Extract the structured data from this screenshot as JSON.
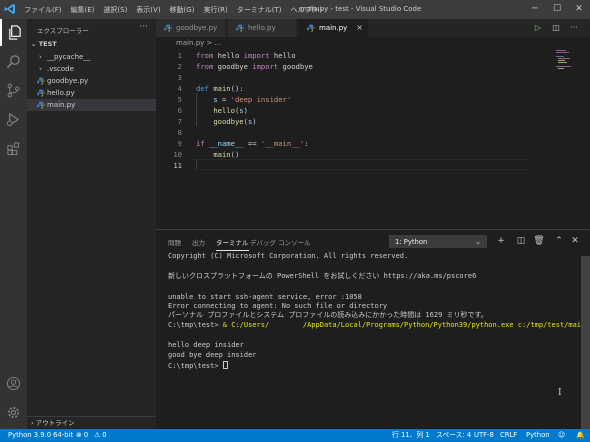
{
  "titlebar": {
    "menu": [
      "ファイル(F)",
      "編集(E)",
      "選択(S)",
      "表示(V)",
      "移動(G)",
      "実行(R)",
      "ターミナル(T)",
      "ヘルプ(H)"
    ],
    "title": "main.py - test - Visual Studio Code",
    "controls": {
      "minimize": "─",
      "maximize": "☐",
      "close": "✕"
    }
  },
  "activity_bar": {
    "items": [
      "explorer-icon",
      "search-icon",
      "source-control-icon",
      "run-debug-icon",
      "extensions-icon"
    ],
    "bottom": [
      "account-icon",
      "settings-gear-icon"
    ]
  },
  "sidebar": {
    "header": "エクスプローラー",
    "more": "···",
    "folder": "TEST",
    "items": [
      {
        "label": "__pycache__",
        "type": "folder"
      },
      {
        "label": ".vscode",
        "type": "folder"
      },
      {
        "label": "goodbye.py",
        "type": "python"
      },
      {
        "label": "hello.py",
        "type": "python"
      },
      {
        "label": "main.py",
        "type": "python",
        "selected": true
      }
    ],
    "outline": "アウトライン"
  },
  "tabs": [
    {
      "label": "goodbye.py",
      "active": false
    },
    {
      "label": "hello.py",
      "active": false
    },
    {
      "label": "main.py",
      "active": true,
      "close": "×"
    }
  ],
  "breadcrumb": "main.py > ...",
  "editor": {
    "lines": [
      {
        "n": "1",
        "tokens": [
          [
            "kw",
            "from"
          ],
          [
            "plain",
            " hello "
          ],
          [
            "kw",
            "import"
          ],
          [
            "plain",
            " hello"
          ]
        ]
      },
      {
        "n": "2",
        "tokens": [
          [
            "kw",
            "from"
          ],
          [
            "plain",
            " goodbye "
          ],
          [
            "kw",
            "import"
          ],
          [
            "plain",
            " goodbye"
          ]
        ]
      },
      {
        "n": "3",
        "tokens": []
      },
      {
        "n": "4",
        "tokens": [
          [
            "kw2",
            "def"
          ],
          [
            "plain",
            " "
          ],
          [
            "fn",
            "main"
          ],
          [
            "plain",
            "():"
          ]
        ]
      },
      {
        "n": "5",
        "tokens": [
          [
            "plain",
            "    "
          ],
          [
            "var",
            "s"
          ],
          [
            "plain",
            " = "
          ],
          [
            "str",
            "'deep insider'"
          ]
        ]
      },
      {
        "n": "6",
        "tokens": [
          [
            "plain",
            "    "
          ],
          [
            "fn",
            "hello"
          ],
          [
            "plain",
            "("
          ],
          [
            "var",
            "s"
          ],
          [
            "plain",
            ")"
          ]
        ]
      },
      {
        "n": "7",
        "tokens": [
          [
            "plain",
            "    "
          ],
          [
            "fn",
            "goodbye"
          ],
          [
            "plain",
            "("
          ],
          [
            "var",
            "s"
          ],
          [
            "plain",
            ")"
          ]
        ]
      },
      {
        "n": "8",
        "tokens": []
      },
      {
        "n": "9",
        "tokens": [
          [
            "kw",
            "if"
          ],
          [
            "plain",
            " "
          ],
          [
            "var",
            "__name__"
          ],
          [
            "plain",
            " == "
          ],
          [
            "str",
            "'__main__'"
          ],
          [
            "plain",
            ":"
          ]
        ]
      },
      {
        "n": "10",
        "tokens": [
          [
            "plain",
            "    "
          ],
          [
            "fn",
            "main"
          ],
          [
            "plain",
            "()"
          ]
        ]
      },
      {
        "n": "11",
        "tokens": [],
        "current": true
      }
    ]
  },
  "panel": {
    "tabs": [
      "問題",
      "出力",
      "ターミナル",
      "デバッグ コンソール"
    ],
    "active_tab": "ターミナル",
    "terminal_select": "1: Python",
    "terminal_lines": [
      "Copyright (C) Microsoft Corporation. All rights reserved.",
      "",
      "新しいクロスプラットフォームの PowerShell をお試しください https://aka.ms/pscore6",
      "",
      "unable to start ssh-agent service, error :1058",
      "Error connecting to agent: No such file or directory",
      "パーソナル プロファイルとシステム プロファイルの読み込みにかかった時間は 1629 ミリ秒です。"
    ],
    "command": {
      "prompt": "C:\\tmp\\test> ",
      "text": "& C:/Users/        /AppData/Local/Programs/Python/Python39/python.exe c:/tmp/test/main.py"
    },
    "output_lines": [
      "hello deep insider",
      "good bye deep insider",
      "C:\\tmp\\test> "
    ]
  },
  "statusbar": {
    "python": "Python 3.9.0 64-bit",
    "errors": "⊗ 0",
    "warnings": "⚠ 0",
    "position": "行 11、列 1",
    "spaces": "スペース: 4",
    "encoding": "UTF-8",
    "eol": "CRLF",
    "language": "Python"
  },
  "colors": {
    "statusbar": "#007acc",
    "activity_bar": "#333333",
    "sidebar": "#252526",
    "editor": "#1e1e1e",
    "keyword": "#c586c0",
    "string": "#ce9178",
    "function": "#dcdcaa",
    "command": "#e5e510"
  }
}
